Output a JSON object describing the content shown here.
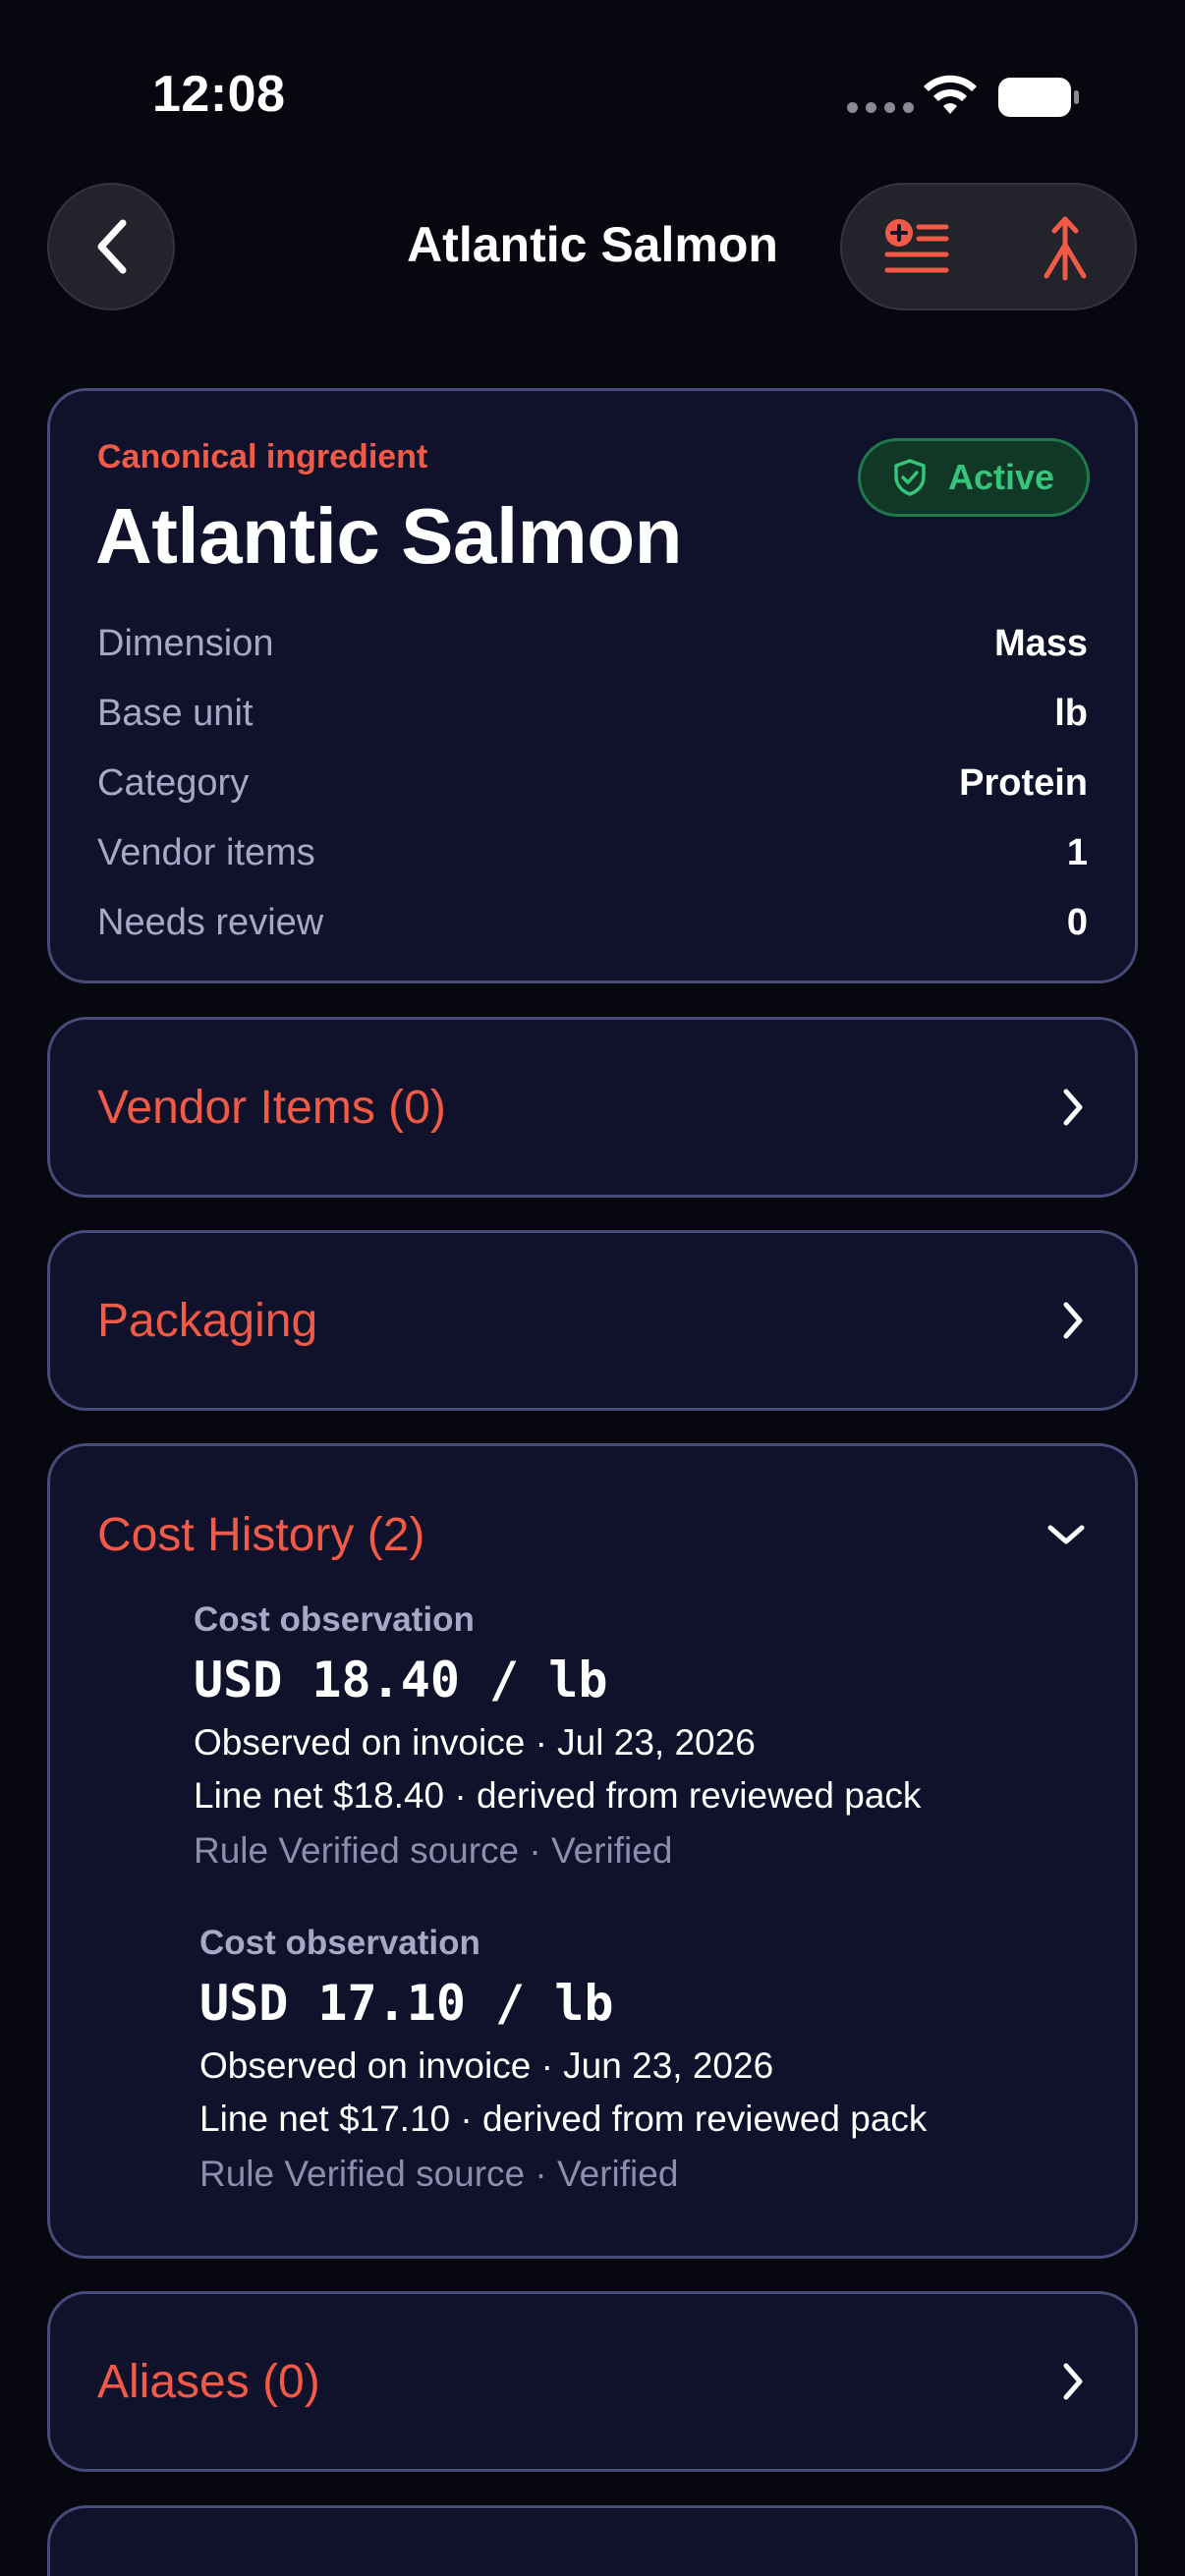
{
  "status_bar": {
    "time": "12:08"
  },
  "nav": {
    "title": "Atlantic Salmon",
    "back_icon": "chevron-left-icon",
    "action_left_icon": "add-list-icon",
    "action_right_icon": "merge-icon"
  },
  "summary": {
    "eyebrow": "Canonical ingredient",
    "title": "Atlantic Salmon",
    "badge": "Active",
    "rows": [
      {
        "label": "Dimension",
        "value": "Mass"
      },
      {
        "label": "Base unit",
        "value": "lb"
      },
      {
        "label": "Category",
        "value": "Protein"
      },
      {
        "label": "Vendor items",
        "value": "1"
      },
      {
        "label": "Needs review",
        "value": "0"
      }
    ]
  },
  "sections": {
    "vendor_items": "Vendor Items (0)",
    "packaging": "Packaging",
    "cost_history": "Cost History (2)",
    "aliases": "Aliases (0)"
  },
  "cost_history": {
    "observations": [
      {
        "label": "Cost observation",
        "price": "USD 18.40 / lb",
        "observed": "Observed on invoice · Jul 23, 2026",
        "line": "Line net $18.40 · derived from reviewed pack",
        "rule": "Rule Verified source · Verified"
      },
      {
        "label": "Cost observation",
        "price": "USD 17.10 / lb",
        "observed": "Observed on invoice · Jun 23, 2026",
        "line": "Line net $17.10 · derived from reviewed pack",
        "rule": "Rule Verified source · Verified"
      }
    ]
  },
  "colors": {
    "accent": "#f05a47",
    "active_green": "#36c57a",
    "card_bg": "#10112a",
    "card_border": "#474b7a",
    "background": "#07070f"
  }
}
